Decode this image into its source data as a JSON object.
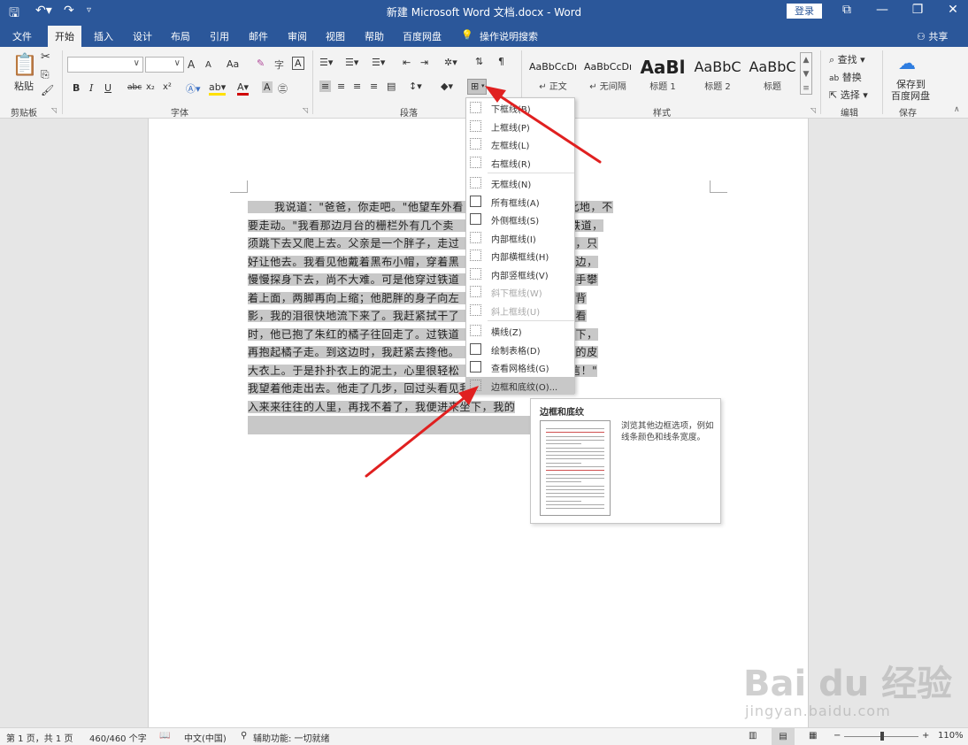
{
  "window": {
    "title": "新建 Microsoft Word 文档.docx  -  Word",
    "login_label": "登录"
  },
  "tabs": [
    "文件",
    "开始",
    "插入",
    "设计",
    "布局",
    "引用",
    "邮件",
    "审阅",
    "视图",
    "帮助",
    "百度网盘"
  ],
  "active_tab": "开始",
  "tell_me": "操作说明搜索",
  "share_label": "共享",
  "ribbon": {
    "clipboard": {
      "paste_label": "粘贴",
      "group_label": "剪贴板"
    },
    "font": {
      "group_label": "字体",
      "grow": "A",
      "shrink": "A",
      "case": "Aa",
      "bold": "B",
      "italic": "I",
      "underline": "U",
      "strike": "abc",
      "sub": "x₂",
      "sup": "x²"
    },
    "paragraph": {
      "group_label": "段落"
    },
    "styles": {
      "group_label": "样式",
      "items": [
        {
          "sample": "AaBbCcDı",
          "name": "↵ 正文"
        },
        {
          "sample": "AaBbCcDı",
          "name": "↵ 无间隔"
        },
        {
          "sample": "AaBl",
          "name": "标题 1"
        },
        {
          "sample": "AaBbC",
          "name": "标题 2"
        },
        {
          "sample": "AaBbC",
          "name": "标题"
        }
      ]
    },
    "editing": {
      "group_label": "编辑",
      "find": "查找",
      "replace": "替换",
      "select": "选择"
    },
    "save": {
      "group_label": "保存",
      "line1": "保存到",
      "line2": "百度网盘"
    }
  },
  "document": {
    "lines": [
      {
        "text": "我说道：\"爸爸，你走吧。\"他望车外看",
        "rest": "    一橘子去。你就在此地，不",
        "indent": true
      },
      {
        "text": "要走动。\"我看那边月台的栅栏外有几个卖",
        "rest": "    到那边月台，须穿过铁道，",
        "indent": false
      },
      {
        "text": "须跳下去又爬上去。父亲是一个胖子，走过",
        "rest": "    本来要去的，他不肯，只",
        "indent": false
      },
      {
        "text": "好让他去。我看见他戴着黑布小帽，穿着黑",
        "rest": "    袍，蹒跚地走到铁道边，",
        "indent": false
      },
      {
        "text": "慢慢探身下去，尚不大难。可是他穿过铁道",
        "rest": "    就不容易了。他用两手攀",
        "indent": false
      },
      {
        "text": "着上面，两脚再向上缩；他肥胖的身子向左",
        "rest": "    子。这时我看见他的背",
        "indent": false
      },
      {
        "text": "影，我的泪很快地流下来了。我赶紧拭干了",
        "rest": "    别人看见。我再向外看",
        "indent": false
      },
      {
        "text": "时，他已抱了朱红的橘子往回走了。过铁道",
        "rest": "    在地上，自己慢慢爬下，",
        "indent": false
      },
      {
        "text": "再抱起橘子走。到这边时，我赶紧去搀他。",
        "rest": "    橘子一股脑儿放在我的皮",
        "indent": false
      },
      {
        "text": "大衣上。于是扑扑衣上的泥土，心里很轻松",
        "rest": "    \"我走了，到那边来信！\"",
        "indent": false
      },
      {
        "text": "我望着他走出去。他走了几步，回过头看见我，说：\"进",
        "rest": "",
        "indent": false
      },
      {
        "text": "入来来往往的人里，再找不着了，我便进来坐下，我的",
        "rest": "",
        "indent": false
      }
    ]
  },
  "borders_menu": {
    "items": [
      {
        "label": "下框线(B)",
        "disabled": false
      },
      {
        "label": "上框线(P)",
        "disabled": false
      },
      {
        "label": "左框线(L)",
        "disabled": false
      },
      {
        "label": "右框线(R)",
        "disabled": false
      },
      {
        "label": "无框线(N)",
        "disabled": false
      },
      {
        "label": "所有框线(A)",
        "disabled": false
      },
      {
        "label": "外侧框线(S)",
        "disabled": false
      },
      {
        "label": "内部框线(I)",
        "disabled": false
      },
      {
        "label": "内部横框线(H)",
        "disabled": false
      },
      {
        "label": "内部竖框线(V)",
        "disabled": false
      },
      {
        "label": "斜下框线(W)",
        "disabled": true
      },
      {
        "label": "斜上框线(U)",
        "disabled": true
      },
      {
        "label": "横线(Z)",
        "disabled": false
      },
      {
        "label": "绘制表格(D)",
        "disabled": false
      },
      {
        "label": "查看网格线(G)",
        "disabled": false
      },
      {
        "label": "边框和底纹(O)...",
        "disabled": false,
        "selected": true
      }
    ]
  },
  "tooltip": {
    "title": "边框和底纹",
    "description": "浏览其他边框选项，例如线条颜色和线条宽度。"
  },
  "status": {
    "page": "第 1 页，共 1 页",
    "words": "460/460 个字",
    "language": "中文(中国)",
    "accessibility": "辅助功能: 一切就绪",
    "zoom": "110%"
  },
  "watermark": {
    "logo": "Bai du 经验",
    "url": "jingyan.baidu.com"
  },
  "colors": {
    "titlebar": "#2b579a",
    "ribbon": "#f3f3f3",
    "arrow": "#e02020",
    "selection": "#c8c8c8"
  }
}
